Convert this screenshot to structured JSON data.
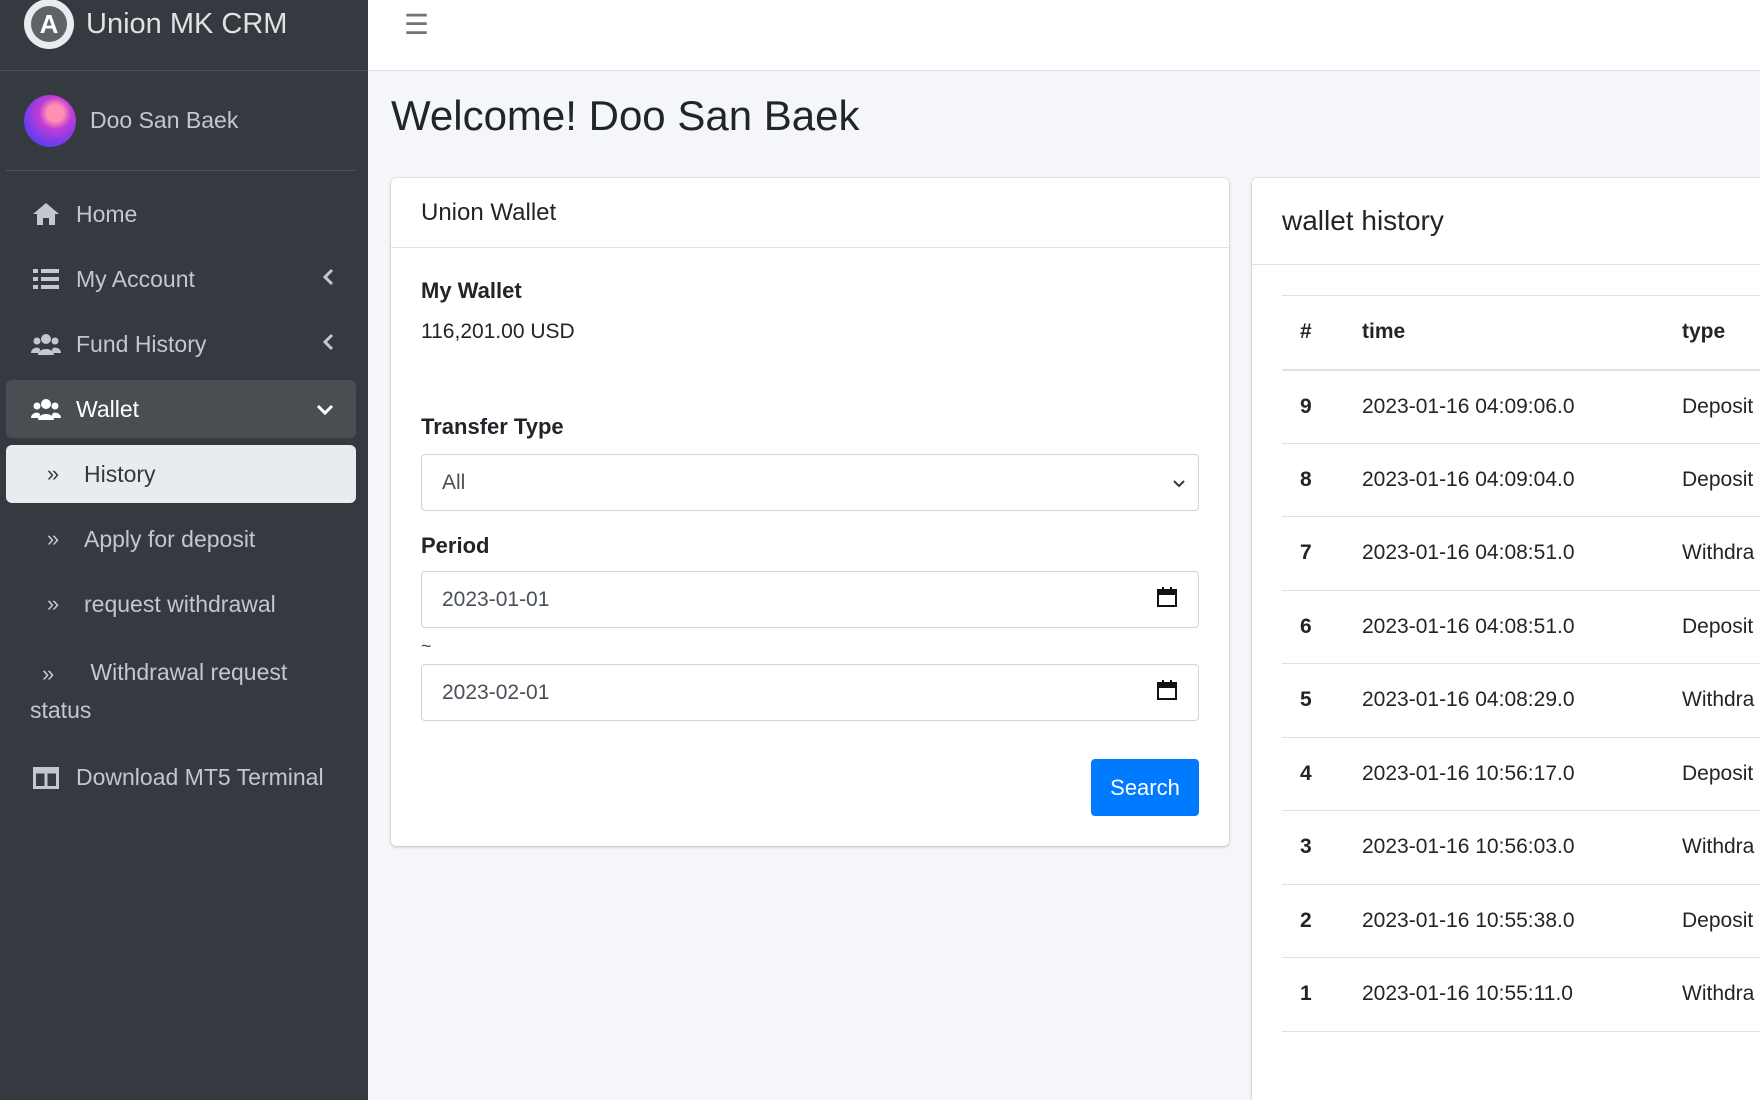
{
  "brand": {
    "title": "Union MK CRM",
    "logo_letter": "A"
  },
  "user": {
    "name": "Doo San Baek"
  },
  "nav": {
    "home": "Home",
    "my_account": "My Account",
    "fund_history": "Fund History",
    "wallet": "Wallet",
    "history": "History",
    "apply_deposit": "Apply for deposit",
    "request_withdrawal": "request withdrawal",
    "withdrawal_status": "Withdrawal request status",
    "download_mt5": "Download MT5 Terminal"
  },
  "page": {
    "title": "Welcome! Doo San Baek"
  },
  "wallet_card": {
    "header": "Union Wallet",
    "my_wallet_label": "My Wallet",
    "balance": "116,201.00 USD",
    "transfer_type_label": "Transfer Type",
    "transfer_type_value": "All",
    "period_label": "Period",
    "period_start": "2023-01-01",
    "period_separator": "~",
    "period_end": "2023-02-01",
    "search_label": "Search"
  },
  "history_card": {
    "header": "wallet history",
    "columns": {
      "idx": "#",
      "time": "time",
      "type": "type"
    },
    "rows": [
      {
        "idx": "9",
        "time": "2023-01-16 04:09:06.0",
        "type": "Deposit"
      },
      {
        "idx": "8",
        "time": "2023-01-16 04:09:04.0",
        "type": "Deposit"
      },
      {
        "idx": "7",
        "time": "2023-01-16 04:08:51.0",
        "type": "Withdra"
      },
      {
        "idx": "6",
        "time": "2023-01-16 04:08:51.0",
        "type": "Deposit"
      },
      {
        "idx": "5",
        "time": "2023-01-16 04:08:29.0",
        "type": "Withdra"
      },
      {
        "idx": "4",
        "time": "2023-01-16 10:56:17.0",
        "type": "Deposit"
      },
      {
        "idx": "3",
        "time": "2023-01-16 10:56:03.0",
        "type": "Withdra"
      },
      {
        "idx": "2",
        "time": "2023-01-16 10:55:38.0",
        "type": "Deposit"
      },
      {
        "idx": "1",
        "time": "2023-01-16 10:55:11.0",
        "type": "Withdra"
      }
    ]
  },
  "colors": {
    "sidebar": "#343a40",
    "accent": "#007bff",
    "page_bg": "#f4f6f9"
  }
}
